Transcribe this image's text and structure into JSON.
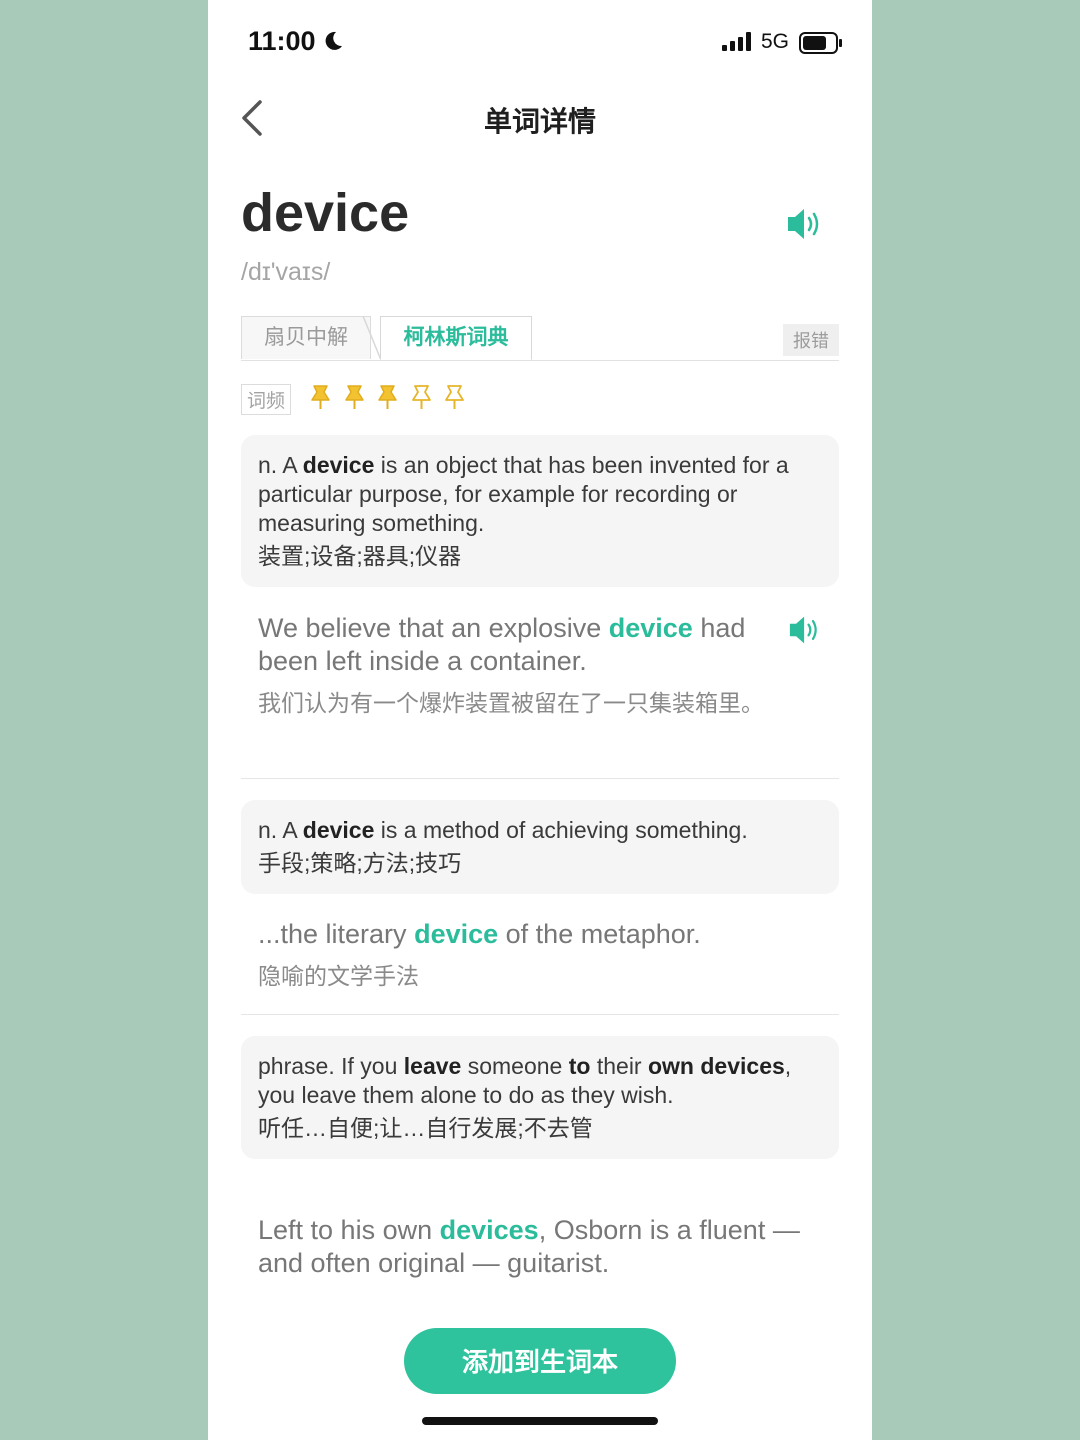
{
  "status_bar": {
    "time": "11:00",
    "network": "5G"
  },
  "nav": {
    "title": "单词详情"
  },
  "word": {
    "headword": "device",
    "phonetic": "/dɪ'vaɪs/"
  },
  "tabs": [
    {
      "label": "扇贝中解"
    },
    {
      "label": "柯林斯词典"
    }
  ],
  "report_label": "报错",
  "frequency": {
    "label": "词频",
    "filled": 3,
    "total": 5
  },
  "senses": [
    {
      "definition": {
        "pos": "n.",
        "pre": "A",
        "word": "device",
        "post": "is an object that has been invented for a particular purpose, for example for recording or measuring something."
      },
      "translation": "装置;设备;器具;仪器",
      "example": {
        "pre": "We believe that an explosive",
        "hl": "device",
        "post": "had been left inside a container.",
        "translation": "我们认为有一个爆炸装置被留在了一只集装箱里。"
      }
    },
    {
      "definition": {
        "pos": "n.",
        "pre": "A",
        "word": "device",
        "post": "is a method of achieving something."
      },
      "translation": "手段;策略;方法;技巧",
      "example": {
        "pre": "...the literary",
        "hl": "device",
        "post": "of the metaphor.",
        "translation": "隐喻的文学手法"
      }
    },
    {
      "definition": {
        "pos": "phrase.",
        "t1": "If you",
        "b1": "leave",
        "t2": "someone",
        "b2": "to",
        "t3": "their",
        "b3": "own",
        "b4": "devices",
        "t4": ", you leave them alone to do as they wish."
      },
      "translation": "听任…自便;让…自行发展;不去管",
      "example": {
        "pre": "Left to his own",
        "hl": "devices",
        "post": ", Osborn is a fluent — and often original — guitarist."
      }
    }
  ],
  "add_button": "添加到生词本",
  "colors": {
    "accent": "#2bbc9b",
    "button": "#2ec29d",
    "pin": "#f2c231",
    "background": "#a8cbb9"
  }
}
